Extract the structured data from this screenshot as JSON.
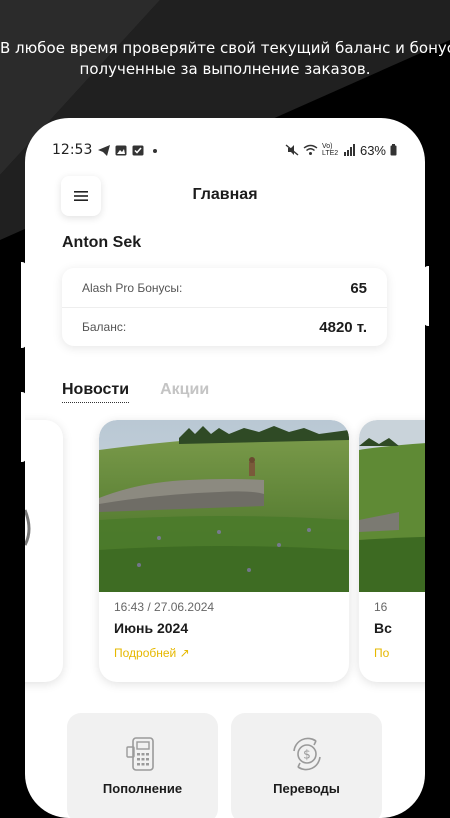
{
  "caption": {
    "line1": "В любое время проверяйте свой текущий баланс и бонусы,",
    "line2": "полученные за выполнение заказов."
  },
  "status_bar": {
    "time": "12:53",
    "network_label": "Vo) LTE2",
    "battery": "63%"
  },
  "header": {
    "title": "Главная",
    "menu_icon": "hamburger-menu-icon"
  },
  "user": {
    "name": "Anton Sek"
  },
  "balance_card": {
    "bonus_label": "Alash Pro Бонусы:",
    "bonus_value": "65",
    "balance_label": "Баланс:",
    "balance_value": "4820 т."
  },
  "tabs": {
    "news": "Новости",
    "promos": "Акции"
  },
  "news": [
    {
      "date": "16:43 / 27.06.2024",
      "title": "Июнь 2024",
      "more": "Подробней ↗"
    },
    {
      "date": "16",
      "title": "Вс",
      "more": "По"
    }
  ],
  "actions": {
    "topup": "Пополнение",
    "transfers": "Переводы"
  },
  "colors": {
    "accent_link": "#e6b800",
    "background": "#000000",
    "card_bg": "#f1f1f1"
  }
}
